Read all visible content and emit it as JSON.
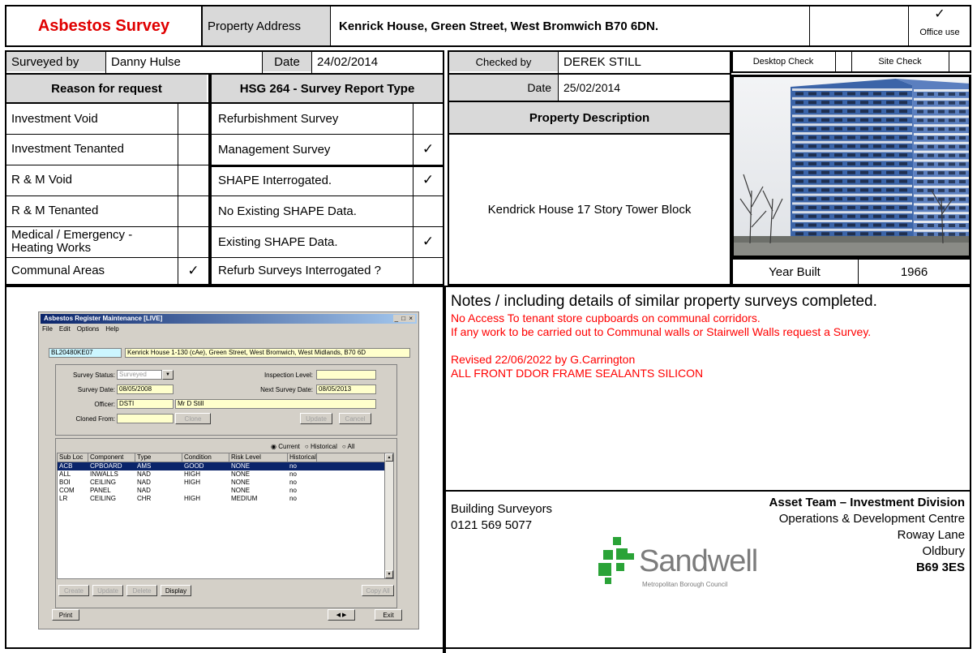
{
  "header": {
    "title": "Asbestos Survey",
    "address_label": "Property Address",
    "address": "Kenrick House, Green Street, West Bromwich B70 6DN.",
    "office_tick": "✓",
    "office_use": "Office use"
  },
  "survey_row": {
    "surveyed_by_label": "Surveyed by",
    "surveyed_by": "Danny Hulse",
    "date_label": "Date",
    "date": "24/02/2014",
    "checked_by_label": "Checked by",
    "checked_by": "DEREK  STILL",
    "desktop_check": "Desktop Check",
    "site_check": "Site Check"
  },
  "reason": {
    "header": "Reason for request",
    "items": [
      {
        "label": "Investment Void",
        "tick": ""
      },
      {
        "label": "Investment Tenanted",
        "tick": ""
      },
      {
        "label": "R & M Void",
        "tick": ""
      },
      {
        "label": "R & M Tenanted",
        "tick": ""
      },
      {
        "label": "Medical / Emergency - Heating Works",
        "tick": ""
      },
      {
        "label": "Communal Areas",
        "tick": "✓"
      }
    ]
  },
  "hsg": {
    "header": "HSG 264 - Survey Report Type",
    "items": [
      {
        "label": "Refurbishment Survey",
        "tick": ""
      },
      {
        "label": "Management Survey",
        "tick": "✓"
      },
      {
        "label": "SHAPE Interrogated.",
        "tick": "✓"
      },
      {
        "label": "No Existing SHAPE Data.",
        "tick": ""
      },
      {
        "label": "Existing SHAPE Data.",
        "tick": "✓"
      },
      {
        "label": "Refurb Surveys Interrogated ?",
        "tick": ""
      }
    ]
  },
  "checked": {
    "date_label": "Date",
    "date": "25/02/2014",
    "property_description_label": "Property Description",
    "property_description": "Kendrick  House 17 Story Tower Block"
  },
  "photo": {
    "year_built_label": "Year Built",
    "year_built": "1966"
  },
  "notes": {
    "heading": "Notes / including details of similar property surveys completed.",
    "lines": [
      "No Access To tenant store cupboards on communal corridors.",
      "If any work to be carried out to Communal walls or Stairwell Walls request a Survey.",
      "",
      "Revised 22/06/2022 by G.Carrington",
      "ALL FRONT DDOR FRAME SEALANTS SILICON"
    ]
  },
  "footer": {
    "dept": "Building Surveyors",
    "phone": "0121 569 5077",
    "team": "Asset Team – Investment Division",
    "address_lines": [
      "Operations & Development Centre",
      "Roway Lane",
      "Oldbury",
      "B69 3ES"
    ],
    "logo_name": "Sandwell",
    "logo_sub": "Metropolitan Borough Council"
  },
  "app": {
    "title": "Asbestos Register Maintenance [LIVE]",
    "menu": [
      "File",
      "Edit",
      "Options",
      "Help"
    ],
    "ref": "BL20480KE07",
    "address": "Kenrick House 1-130 (cAe), Green Street, West Bromwich, West Midlands, B70 6D",
    "survey_status_label": "Survey Status:",
    "survey_status": "Surveyed",
    "inspection_level_label": "Inspection Level:",
    "survey_date_label": "Survey Date:",
    "survey_date": "08/05/2008",
    "next_survey_label": "Next Survey Date:",
    "next_survey": "08/05/2013",
    "officer_label": "Officer:",
    "officer_code": "DSTI",
    "officer_name": "Mr D Still",
    "cloned_from_label": "Cloned From:",
    "clone_btn": "Clone",
    "update_btn": "Update",
    "cancel_btn": "Cancel",
    "radio_current": "Current",
    "radio_historical": "Historical",
    "radio_all": "All",
    "columns": [
      "Sub Loc",
      "Component",
      "Type",
      "Condition",
      "Risk Level",
      "Historical"
    ],
    "rows": [
      [
        "ACB",
        "CPBOARD",
        "AMS",
        "GOOD",
        "NONE",
        "no"
      ],
      [
        "ALL",
        "INWALLS",
        "NAD",
        "HIGH",
        "NONE",
        "no"
      ],
      [
        "BOI",
        "CEILING",
        "NAD",
        "HIGH",
        "NONE",
        "no"
      ],
      [
        "COM",
        "PANEL",
        "NAD",
        "",
        "NONE",
        "no"
      ],
      [
        "LR",
        "CEILING",
        "CHR",
        "HIGH",
        "MEDIUM",
        "no"
      ]
    ],
    "create_btn": "Create",
    "update2_btn": "Update",
    "delete_btn": "Delete",
    "display_btn": "Display",
    "copy_all_btn": "Copy All",
    "print_btn": "Print",
    "exit_btn": "Exit",
    "nav_glyph": "◀ ▶",
    "win_buttons": "_ □ ×",
    "scroll_up": "▲",
    "scroll_down": "▼",
    "combo_arrow": "▼",
    "radio_on": "◉",
    "radio_off": "○"
  },
  "colors": {
    "title_red": "#e00000",
    "notes_red": "#ff0000",
    "grey": "#d9d9d9",
    "logo_green": "#2aa337"
  }
}
